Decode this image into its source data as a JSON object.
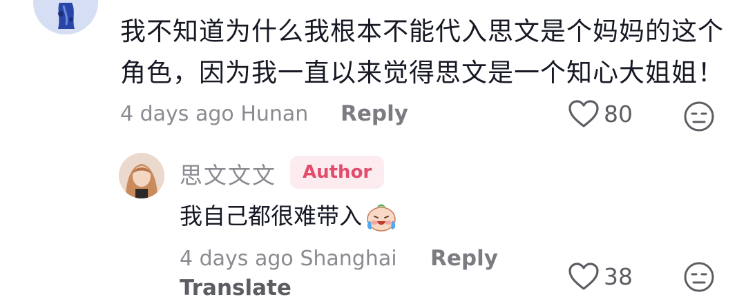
{
  "main_comment": {
    "line1": "我不知道为什么我根本不能代入思文是个妈妈的这个",
    "line2": "角色，因为我一直以来觉得思文是一个知心大姐姐！",
    "time": "4 days ago",
    "location": "Hunan",
    "reply_label": "Reply",
    "like_count": "80"
  },
  "reply_comment": {
    "username": "思文文文",
    "badge": "Author",
    "text": "我自己都很难带入",
    "emoji": "crying-laughing-peach-emoji",
    "time": "4 days ago",
    "location": "Shanghai",
    "reply_label": "Reply",
    "translate_label": "Translate",
    "like_count": "38"
  },
  "colors": {
    "text_primary": "#161823",
    "text_secondary": "#8a8b91",
    "badge_bg": "#fcebef",
    "badge_text": "#e34b6b"
  },
  "icons": {
    "like": "heart-outline-icon",
    "dislike": "neutral-face-icon"
  }
}
